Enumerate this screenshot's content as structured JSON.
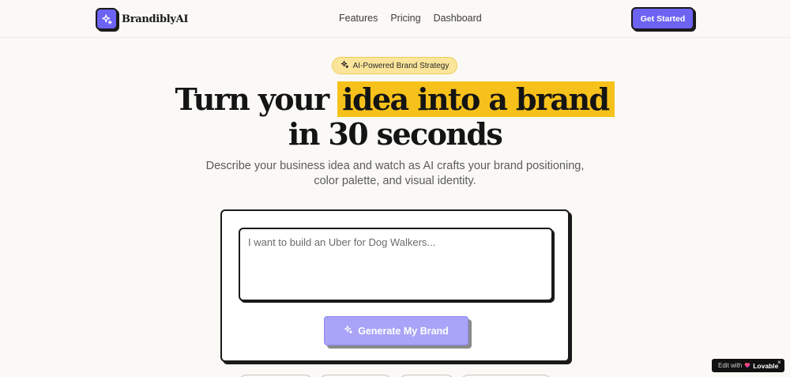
{
  "header": {
    "brand_name": "BrandiblyAI",
    "nav": [
      "Features",
      "Pricing",
      "Dashboard"
    ],
    "cta_label": "Get Started"
  },
  "hero": {
    "badge_label": "AI-Powered Brand Strategy",
    "headline_part1": "Turn your",
    "headline_highlight": "idea into a brand",
    "headline_line2": "in 30 seconds",
    "subtitle": "Describe your business idea and watch as AI crafts your brand positioning, color palette, and visual identity."
  },
  "form": {
    "idea_placeholder": "I want to build an Uber for Dog Walkers...",
    "idea_value": "",
    "generate_label": "Generate My Brand"
  },
  "lovable_badge": {
    "prefix": "Edit with",
    "brand": "Lovable",
    "close": "×"
  },
  "colors": {
    "accent": "#6c63f2",
    "accent_disabled": "#a9a4f7",
    "highlight": "#f7c11b",
    "badge_bg": "#fbe59a",
    "page_bg": "#fbf9f5"
  },
  "icons": {
    "logo": "sparkles-icon",
    "badge": "sparkles-icon",
    "generate": "sparkles-icon"
  }
}
